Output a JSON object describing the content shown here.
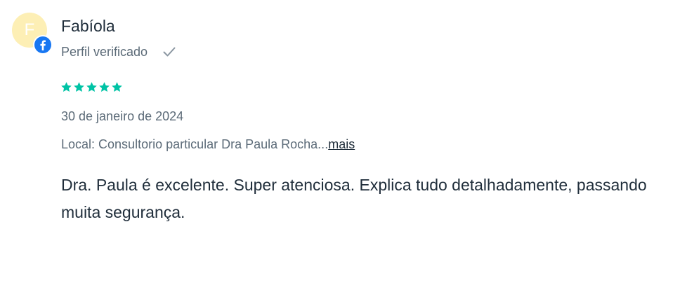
{
  "review": {
    "avatar_initial": "F",
    "author_name": "Fabíola",
    "verified_label": "Perfil verificado",
    "rating": 5,
    "rating_max": 5,
    "date": "30 de janeiro de 2024",
    "location": "Local: Consultorio particular Dra Paula Rocha...",
    "more_label": "mais",
    "comment": "Dra. Paula é excelente. Super atenciosa. Explica tudo detalhadamente, passando muita segurança."
  },
  "icons": {
    "source": "facebook-icon",
    "verified": "check-icon",
    "star": "star-icon"
  },
  "colors": {
    "avatar_bg": "#fdefb5",
    "facebook_blue": "#1877f2",
    "star_green": "#00c3a5",
    "text_primary": "#1f2d3a",
    "text_secondary": "#5c6b78"
  }
}
